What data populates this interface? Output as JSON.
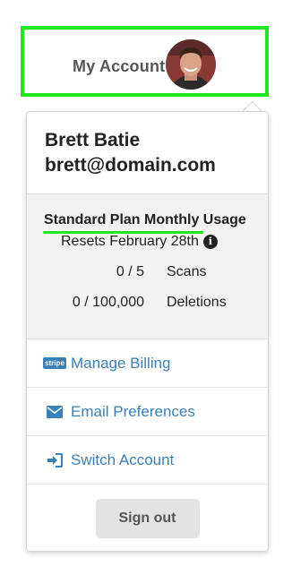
{
  "trigger": {
    "label": "My Account",
    "avatar_alt": "user photo"
  },
  "user": {
    "name": "Brett Batie",
    "email": "brett@domain.com"
  },
  "usage": {
    "plan_label": "Standard Plan Monthly Usage",
    "resets_label": "Resets February 28th",
    "info_icon": "info-icon",
    "stats": [
      {
        "value": "0 / 5",
        "name": "Scans"
      },
      {
        "value": "0 / 100,000",
        "name": "Deletions"
      }
    ]
  },
  "menu": [
    {
      "label": "Manage Billing",
      "icon": "stripe-icon",
      "badge": "stripe"
    },
    {
      "label": "Email Preferences",
      "icon": "envelope-icon"
    },
    {
      "label": "Switch Account",
      "icon": "sign-in-icon"
    }
  ],
  "signout_label": "Sign out",
  "colors": {
    "accent_link": "#3a7fb8",
    "highlight": "#1ee81e"
  }
}
